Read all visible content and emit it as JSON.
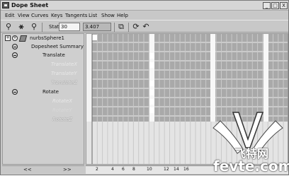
{
  "window": {
    "title": "Dope Sheet",
    "minimize": "_",
    "maximize": "□",
    "close": "X"
  },
  "menu": [
    "Edit",
    "View",
    "Curves",
    "Keys",
    "Tangents",
    "List",
    "Show",
    "Help"
  ],
  "toolbar": {
    "stats_label": "Stats",
    "stats_frame": "30",
    "stats_value": "3.407"
  },
  "outliner": {
    "object": "nurbsSphere1",
    "summary": "Dopesheet Summary",
    "translate": "Translate",
    "translate_channels": [
      "TranslateX",
      "TranslateY",
      "TranslateZ"
    ],
    "rotate": "Rotate",
    "rotate_channels": [
      "RotateX",
      "RotateY",
      "RotateZ"
    ],
    "scroll_left": "<<",
    "scroll_right": ">>"
  },
  "timeline": {
    "ticks": [
      "2",
      "4",
      "6",
      "8",
      "10",
      "12",
      "14",
      "16"
    ]
  },
  "watermark": {
    "zh": "飞特网",
    "en": "fevte.com"
  }
}
